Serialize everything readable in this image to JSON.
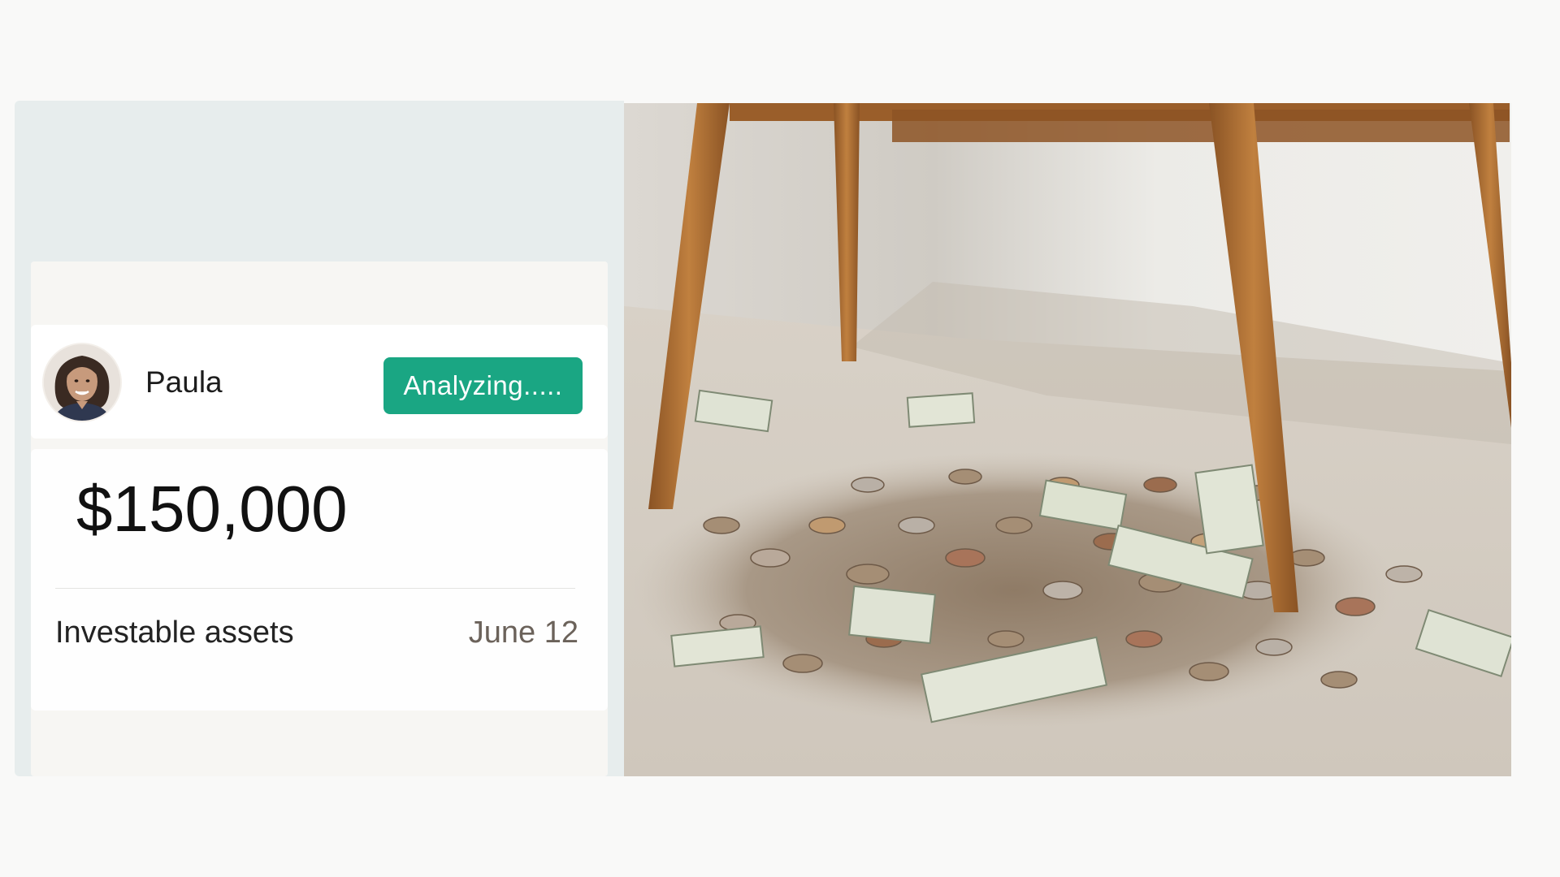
{
  "profile": {
    "name": "Paula",
    "status_label": "Analyzing....."
  },
  "assets": {
    "amount": "$150,000",
    "label": "Investable assets",
    "date": "June 12"
  },
  "colors": {
    "accent": "#1aa683",
    "panel": "#e7eded",
    "background": "#f9f9f8"
  }
}
